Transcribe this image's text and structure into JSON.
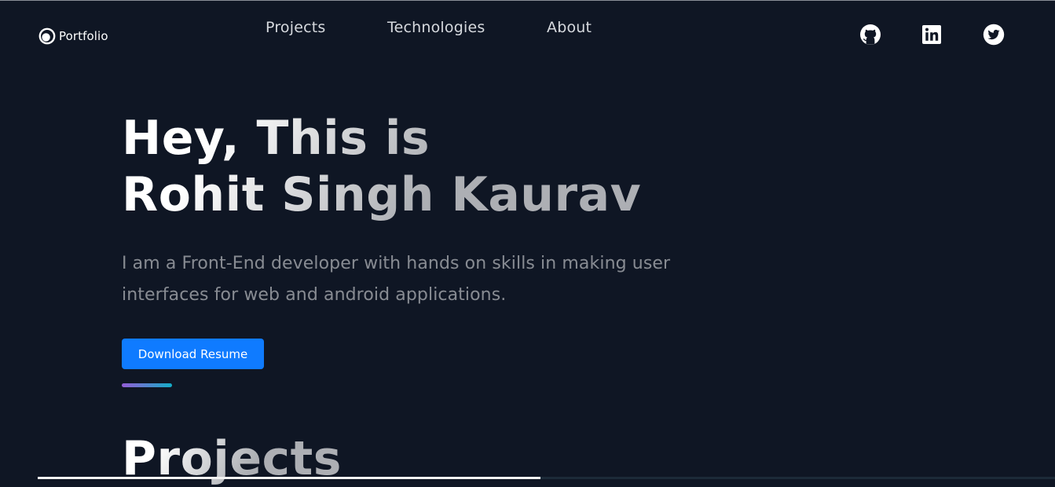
{
  "header": {
    "logo_text": "Portfolio",
    "nav": [
      {
        "label": "Projects"
      },
      {
        "label": "Technologies"
      },
      {
        "label": "About"
      }
    ],
    "social_icons": [
      "github-icon",
      "linkedin-icon",
      "twitter-icon"
    ]
  },
  "hero": {
    "title_line1": "Hey, This is",
    "title_line2": "Rohit Singh Kaurav",
    "description": "I am a Front-End developer with hands on skills in making user interfaces for web and android applications.",
    "button_label": "Download Resume"
  },
  "projects": {
    "title": "Projects"
  },
  "colors": {
    "background": "#0f1624",
    "accent_button": "#0f7bff",
    "accent_gradient": [
      "#945dd6",
      "#6978d1",
      "#13adc7"
    ]
  }
}
